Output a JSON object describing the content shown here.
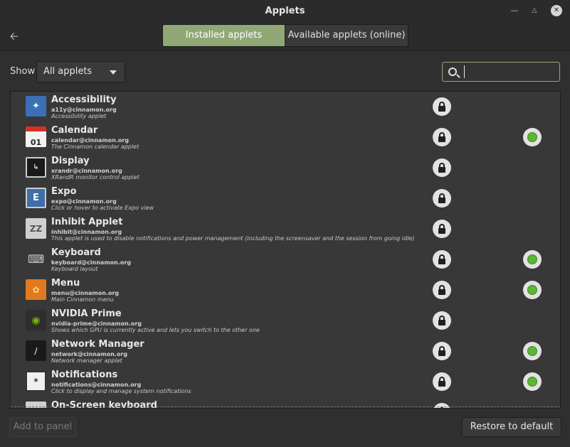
{
  "window": {
    "title": "Applets"
  },
  "header": {
    "tabs": [
      {
        "label": "Installed applets",
        "active": true
      },
      {
        "label": "Available applets (online)",
        "active": false
      }
    ]
  },
  "toolbar": {
    "show_label": "Show",
    "filter_value": "All applets",
    "search_placeholder": ""
  },
  "applets": [
    {
      "name": "Accessibility",
      "uuid": "a11y@cinnamon.org",
      "description": "Accessibility applet",
      "icon": "accessibility-icon",
      "active": false,
      "row_top": 0
    },
    {
      "name": "Calendar",
      "uuid": "calendar@cinnamon.org",
      "description": "The Cinnamon calendar applet",
      "icon": "calendar-icon",
      "active": true
    },
    {
      "name": "Display",
      "uuid": "xrandr@cinnamon.org",
      "description": "XRandR monitor control applet",
      "icon": "display-icon",
      "active": false
    },
    {
      "name": "Expo",
      "uuid": "expo@cinnamon.org",
      "description": "Click or hover to activate Expo view",
      "icon": "expo-icon",
      "active": false
    },
    {
      "name": "Inhibit Applet",
      "uuid": "inhibit@cinnamon.org",
      "description": "This applet is used to disable notifications and power management (including the screensaver and the session from going idle)",
      "icon": "inhibit-icon",
      "active": false
    },
    {
      "name": "Keyboard",
      "uuid": "keyboard@cinnamon.org",
      "description": "Keyboard layout",
      "icon": "keyboard-icon",
      "active": true
    },
    {
      "name": "Menu",
      "uuid": "menu@cinnamon.org",
      "description": "Main Cinnamon menu",
      "icon": "menu-icon",
      "active": true
    },
    {
      "name": "NVIDIA Prime",
      "uuid": "nvidia-prime@cinnamon.org",
      "description": "Shows which GPU is currently active and lets you switch to the other one",
      "icon": "nvidia-icon",
      "active": false
    },
    {
      "name": "Network Manager",
      "uuid": "network@cinnamon.org",
      "description": "Network manager applet",
      "icon": "network-icon",
      "active": true
    },
    {
      "name": "Notifications",
      "uuid": "notifications@cinnamon.org",
      "description": "Click to display and manage system notifications",
      "icon": "notifications-icon",
      "active": true
    },
    {
      "name": "On-Screen keyboard",
      "uuid": "",
      "description": "",
      "icon": "onscreen-keyboard-icon",
      "active": false
    }
  ],
  "footer": {
    "add_label": "Add to panel",
    "restore_label": "Restore to default"
  },
  "colors": {
    "accent": "#8fa876",
    "active_dot": "#5cb533",
    "background": "#2f2f2f"
  }
}
